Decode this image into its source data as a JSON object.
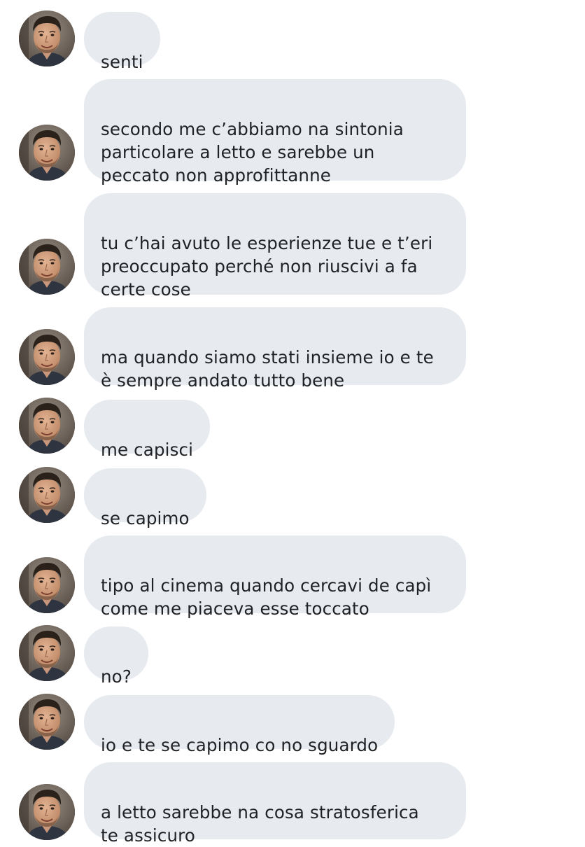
{
  "conversation": {
    "messages": [
      {
        "text": "senti"
      },
      {
        "text": "secondo me c’abbiamo na sintonia\nparticolare a letto e sarebbe un\npeccato non approfittanne"
      },
      {
        "text": "tu c’hai avuto le esperienze tue e t’eri\npreoccupato perché non riuscivi a fa\ncerte cose"
      },
      {
        "text": "ma quando siamo stati insieme io e te\nè sempre andato tutto bene"
      },
      {
        "text": "me capisci"
      },
      {
        "text": "se capimo"
      },
      {
        "text": "tipo al cinema quando cercavi de capì\ncome me piaceva esse toccato"
      },
      {
        "text": "no?"
      },
      {
        "text": "io e te se capimo co no sguardo"
      },
      {
        "text": "a letto sarebbe na cosa stratosferica\nte assicuro"
      }
    ]
  },
  "colors": {
    "bubble_background": "#e7eaef",
    "text": "#1f2125",
    "page_background": "#ffffff"
  },
  "icons": {
    "avatar": "sender-profile-photo"
  }
}
